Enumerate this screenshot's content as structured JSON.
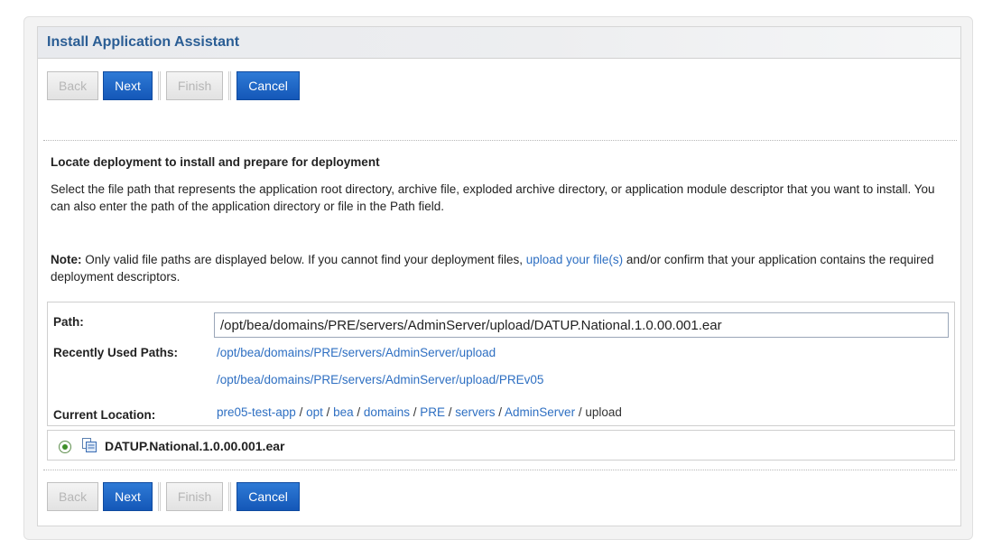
{
  "assistant": {
    "title": "Install Application Assistant"
  },
  "buttons": {
    "back": "Back",
    "next": "Next",
    "finish": "Finish",
    "cancel": "Cancel"
  },
  "content": {
    "heading": "Locate deployment to install and prepare for deployment",
    "description": "Select the file path that represents the application root directory, archive file, exploded archive directory, or application module descriptor that you want to install. You can also enter the path of the application directory or file in the Path field.",
    "note_label": "Note:",
    "note_text_before": " Only valid file paths are displayed below. If you cannot find your deployment files, ",
    "note_link": "upload your file(s)",
    "note_text_after": " and/or confirm that your application contains the required deployment descriptors."
  },
  "path_section": {
    "path_label": "Path:",
    "path_value": "/opt/bea/domains/PRE/servers/AdminServer/upload/DATUP.National.1.0.00.001.ear",
    "recent_label": "Recently Used Paths:",
    "recent_paths": [
      "/opt/bea/domains/PRE/servers/AdminServer/upload",
      "/opt/bea/domains/PRE/servers/AdminServer/upload/PREv05"
    ],
    "current_label": "Current Location:",
    "current_location": [
      "pre05-test-app",
      "opt",
      "bea",
      "domains",
      "PRE",
      "servers",
      "AdminServer",
      "upload"
    ],
    "separator": " / "
  },
  "files": [
    {
      "name": "DATUP.National.1.0.00.001.ear",
      "selected": true,
      "icon": "archive-file-icon"
    }
  ],
  "colors": {
    "title": "#2a5d94",
    "button_active": "#1f68c8",
    "link": "#2e6fc2"
  }
}
